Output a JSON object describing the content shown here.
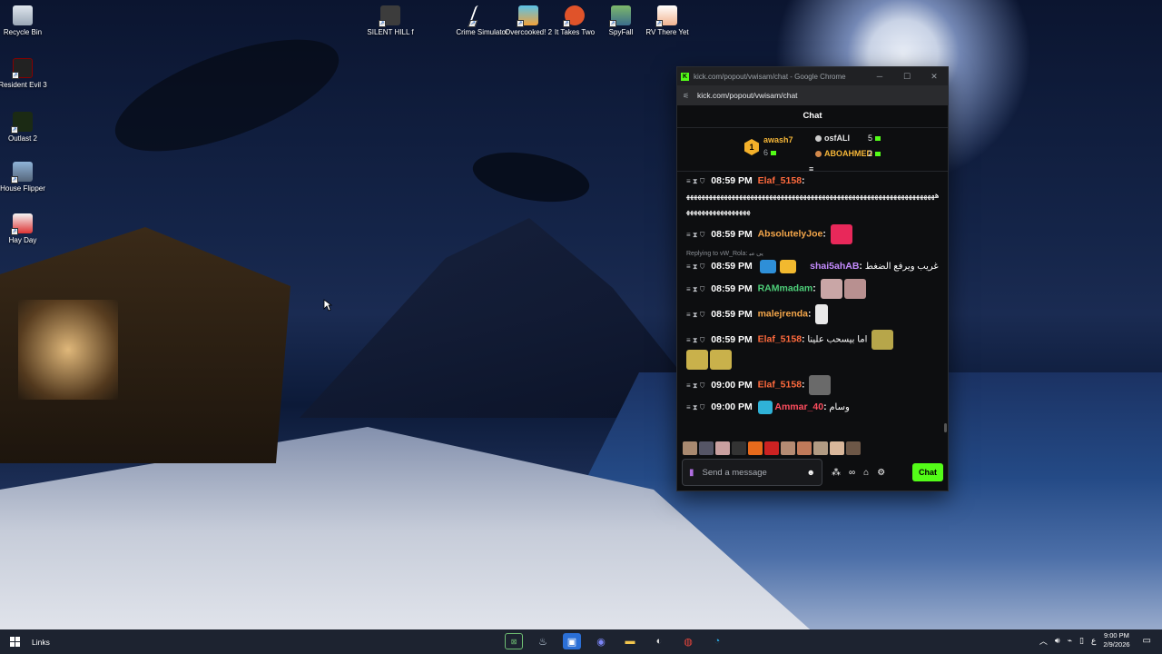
{
  "desktop": {
    "icons_left": [
      {
        "label": "Recycle Bin"
      },
      {
        "label": "Resident Evil 3"
      },
      {
        "label": "Outlast 2"
      },
      {
        "label": "House Flipper"
      },
      {
        "label": "Hay Day"
      }
    ],
    "icons_top": [
      {
        "label": "SILENT HILL f"
      },
      {
        "label": "Crime Simulator"
      },
      {
        "label": "Overcooked! 2"
      },
      {
        "label": "It Takes Two"
      },
      {
        "label": "SpyFall"
      },
      {
        "label": "RV There Yet"
      }
    ]
  },
  "browser": {
    "title": "kick.com/popout/vwisam/chat - Google Chrome",
    "url": "kick.com/popout/vwisam/chat",
    "minimize": "─",
    "maximize": "☐",
    "close": "✕"
  },
  "chat": {
    "header": "Chat",
    "leaderboard": {
      "rank": "1",
      "first_name": "awash7",
      "first_count": "6",
      "second_name": "osfALI",
      "second_count": "5",
      "third_name": "ABOAHMED",
      "third_count": "2"
    },
    "messages": [
      {
        "time": "08:59 PM",
        "user": "Elaf_5158",
        "color": "#ff6a3d",
        "text": "ﻫﻬﻬﻬﻬﻬﻬﻬﻬﻬﻬﻬﻬﻬﻬﻬﻬﻬﻬﻬﻬﻬﻬﻬﻬﻬﻬﻬﻬﻬﻬﻬﻬﻬﻬﻬﻬﻬﻬﻬﻬﻬﻬﻬﻬﻬﻬﻬﻬﻬﻬﻬﻬﻬﻬﻬﻬﻬﻬﻬﻬﻬﻬﻬﻬﻬﻬﻬﻬﻬﻬﻬﻬﻬﻬﻬﻬﻬﻬﻬﻬﻬﻬﻬ"
      },
      {
        "time": "08:59 PM",
        "user": "AbsolutelyJoe",
        "color": "#f4a64a",
        "text": ""
      },
      {
        "reply": "Replying to vW_Rola: ﻳﻰ ﻣﺒ",
        "time": "08:59 PM",
        "user": "shai5ahAB",
        "color": "#c58cff",
        "text": "غريب ويرفع الضغط"
      },
      {
        "time": "08:59 PM",
        "user": "RAMmadam",
        "color": "#4ed07a",
        "text": ""
      },
      {
        "time": "08:59 PM",
        "user": "malejrenda",
        "color": "#f4a64a",
        "text": ""
      },
      {
        "time": "08:59 PM",
        "user": "Elaf_5158",
        "color": "#ff6a3d",
        "text": "اما بيسحب علينا"
      },
      {
        "time": "09:00 PM",
        "user": "Elaf_5158",
        "color": "#ff6a3d",
        "text": ""
      },
      {
        "time": "09:00 PM",
        "user": "Ammar_40",
        "color": "#ff4d5e",
        "text": "وسام"
      }
    ],
    "meta_icons": "≡ ⧗ ⛉",
    "input_placeholder": "Send a message",
    "chat_button": "Chat"
  },
  "taskbar": {
    "links_label": "Links",
    "time": "9:00 PM",
    "date": "2/9/2026",
    "lang": "ع"
  },
  "colors": {
    "kick_green": "#53fc18"
  }
}
